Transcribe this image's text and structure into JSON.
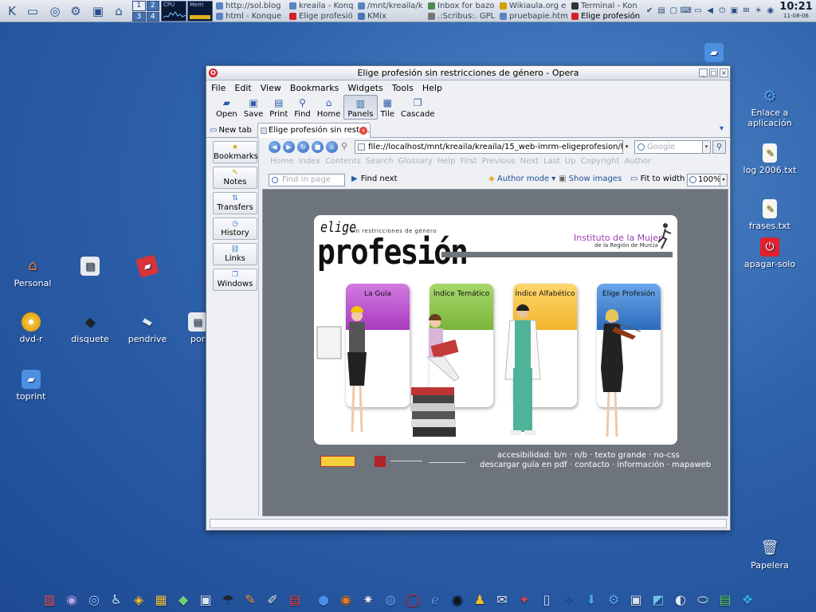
{
  "top_panel": {
    "pager": [
      "1",
      "2",
      "3",
      "4"
    ],
    "cpu_label": "CPU",
    "mem_label": "Mem",
    "tasks": [
      {
        "label": "http://sol.blog",
        "color": "#5a83c2"
      },
      {
        "label": "kreaila - Konq",
        "color": "#5a83c2"
      },
      {
        "label": "/mnt/kreaila/k",
        "color": "#5a83c2"
      },
      {
        "label": "Inbox for bazo",
        "color": "#4f8a4f"
      },
      {
        "label": "Wikiaula.org e",
        "color": "#d4a000"
      },
      {
        "label": "Terminal - Kon",
        "color": "#333333"
      },
      {
        "label": "html - Konque",
        "color": "#5a83c2"
      },
      {
        "label": "Elige profesió",
        "color": "#d3202a"
      },
      {
        "label": "KMix",
        "color": "#4a76b9"
      },
      {
        "label": ".:Scribus:. GPL",
        "color": "#777777"
      },
      {
        "label": "pruebapie.htm",
        "color": "#5a83c2"
      },
      {
        "label": "Elige profesión",
        "color": "#d3202a"
      }
    ],
    "clock_time": "10:21",
    "clock_date": "11-08-06"
  },
  "desktop_icons": [
    {
      "id": "personal",
      "label": "Personal",
      "icon": "home-icon"
    },
    {
      "id": "dvd",
      "label": "dvd-r",
      "icon": "disc-icon"
    },
    {
      "id": "disquete",
      "label": "disquete",
      "icon": "floppy-icon"
    },
    {
      "id": "pendrive",
      "label": "pendrive",
      "icon": "usb-icon"
    },
    {
      "id": "port",
      "label": "port",
      "icon": "drive-icon"
    },
    {
      "id": "toprint",
      "label": "toprint",
      "icon": "folder-icon"
    },
    {
      "id": "enlace",
      "label": "Enlace a aplicación",
      "icon": "gear-icon"
    },
    {
      "id": "log",
      "label": "log 2006.txt",
      "icon": "text-file-icon"
    },
    {
      "id": "frases",
      "label": "frases.txt",
      "icon": "text-file-icon"
    },
    {
      "id": "apagar",
      "label": "apagar-solo",
      "icon": "power-icon"
    },
    {
      "id": "papelera",
      "label": "Papelera",
      "icon": "trash-icon"
    },
    {
      "id": "top",
      "label": "",
      "icon": "folder-icon"
    }
  ],
  "window": {
    "title": "Elige profesión sin restricciones de género - Opera",
    "menu": [
      "File",
      "Edit",
      "View",
      "Bookmarks",
      "Widgets",
      "Tools",
      "Help"
    ],
    "toolbar": [
      "Open",
      "Save",
      "Print",
      "Find",
      "Home",
      "Panels",
      "Tile",
      "Cascade"
    ],
    "new_tab_label": "New tab",
    "active_tab_label": "Elige profesión sin restr...",
    "panels": [
      "Bookmarks",
      "Notes",
      "Transfers",
      "History",
      "Links",
      "Windows"
    ],
    "address": "file://localhost/mnt/kreaila/kreaila/15_web-imrm-eligeprofesion/html/i",
    "search_placeholder": "Google",
    "nav_links": [
      "Home",
      "Index",
      "Contents",
      "Search",
      "Glossary",
      "Help",
      "First",
      "Previous",
      "Next",
      "Last",
      "Up",
      "Copyright",
      "Author"
    ],
    "find_placeholder": "Find in page",
    "find_next_label": "Find next",
    "author_mode_label": "Author mode",
    "show_images_label": "Show images",
    "fit_width_label": "Fit to width",
    "zoom": "100%"
  },
  "site": {
    "logo_small": "elige",
    "tagline": "sin restricciones de género",
    "logo_big": "profesión",
    "institute": "Instituto de la Mujer",
    "institute_sub": "de la Región de Murcia",
    "categories": [
      {
        "label": "La Guía",
        "color": "#a93cc0"
      },
      {
        "label": "Índice Temático",
        "color": "#7ab53a"
      },
      {
        "label": "Índice Alfabético",
        "color": "#f2b42a"
      },
      {
        "label": "Elige Profesión",
        "color": "#2b6cbc"
      }
    ],
    "footer_line1": "accesibilidad:   b/n ·  n/b ·  texto grande ·  no-css",
    "footer_line2": "descargar guía en pdf ·  contacto ·  información ·  mapaweb"
  }
}
